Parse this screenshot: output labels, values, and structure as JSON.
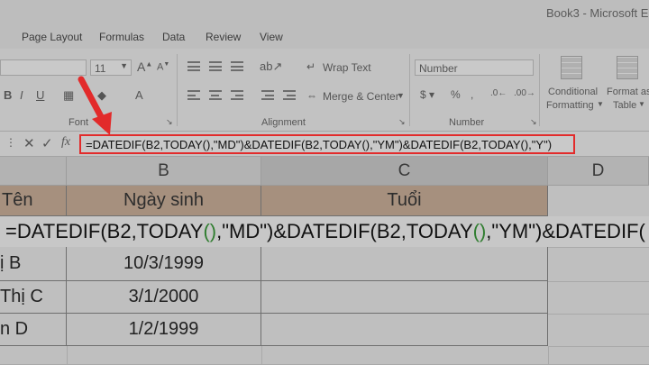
{
  "window": {
    "title": "Book3 - Microsoft E"
  },
  "tabs": [
    "Page Layout",
    "Formulas",
    "Data",
    "Review",
    "View"
  ],
  "ribbon": {
    "font": {
      "size": "11",
      "group_label": "Font",
      "bold": "B"
    },
    "alignment": {
      "wrap_text": "Wrap Text",
      "merge_center": "Merge & Center",
      "group_label": "Alignment"
    },
    "number": {
      "format": "Number",
      "group_label": "Number"
    },
    "styles": {
      "conditional_formatting_line1": "Conditional",
      "conditional_formatting_line2": "Formatting",
      "format_as_table_line1": "Format as",
      "format_as_table_line2": "Table"
    }
  },
  "formula_bar": {
    "fx": "fx",
    "formula": "=DATEDIF(B2,TODAY(),\"MD\")&DATEDIF(B2,TODAY(),\"YM\")&DATEDIF(B2,TODAY(),\"Y\")"
  },
  "sheet": {
    "columns": [
      "B",
      "C",
      "D"
    ],
    "headers": {
      "a": "Tên",
      "b": "Ngày sinh",
      "c": "Tuổi"
    },
    "edit": {
      "p1": "=DATEDIF(B2,TODAY",
      "open": "(",
      "close": ")",
      "p2": ",\"MD\")&DATEDIF(B2,TODAY",
      "p3": ",\"YM\")&DATEDIF(",
      "p4": ""
    },
    "rows": [
      {
        "name": "ị B",
        "dob": "10/3/1999"
      },
      {
        "name": "Thị C",
        "dob": "3/1/2000"
      },
      {
        "name": "n D",
        "dob": "1/2/1999"
      }
    ]
  },
  "colors": {
    "highlight": "#e22b2b",
    "header_fill": "#a6907e",
    "paren_green": "#2f7d2f"
  }
}
